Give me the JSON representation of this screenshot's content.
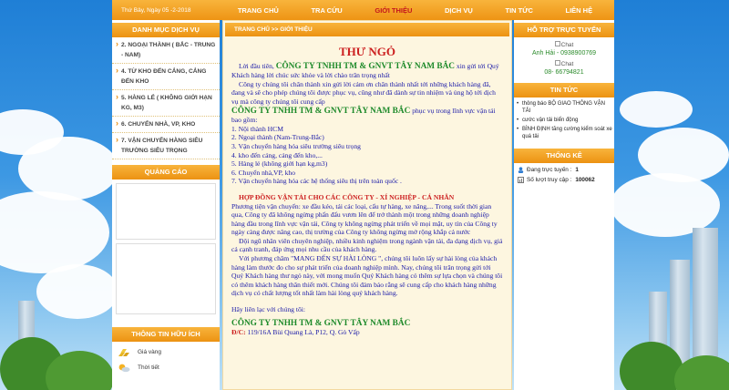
{
  "topbar": {
    "date": "Thứ Bảy, Ngày 05 -2-2018",
    "menu": [
      "TRANG CHỦ",
      "TRA CỨU",
      "GIỚI THIỆU",
      "DỊCH VỤ",
      "TIN TỨC",
      "LIÊN HỆ"
    ],
    "active_index": 2
  },
  "left": {
    "services_title": "DANH MỤC DỊCH VỤ",
    "services": [
      "2. NGOẠI THÀNH ( BẮC - TRUNG - NAM)",
      "4. TỪ KHO ĐẾN CẢNG, CẢNG ĐẾN KHO",
      "5. HÀNG LẺ ( KHÔNG GIỚI HẠN KG, M3)",
      "6. CHUYỂN NHÀ, VP, KHO",
      "7. VẬN CHUYỂN HÀNG SIÊU TRƯỜNG SIÊU TRỌNG"
    ],
    "ads_title": "QUẢNG CÁO",
    "useful_title": "THÔNG TIN HỮU ÍCH",
    "useful": [
      "Giá vàng",
      "Thời tiết"
    ]
  },
  "center": {
    "breadcrumb": "TRANG CHỦ >> GIỚI THIỆU",
    "title": "THƯ NGỎ",
    "company": "CÔNG TY TNHH TM & GNVT TÂY NAM BẮC",
    "intro_pre": "Lời đầu tiên,",
    "intro_post": "xin gửi tới Quý Khách hàng lời chúc sức khỏe và lời chào trân trọng nhất",
    "para1": "Công ty chúng tôi chân thành xin gửi lời cảm ơn chân thành nhất tới những khách hàng đã, đang và sẽ cho phép chúng tôi được phục vụ, cũng như đã dành sự tin nhiệm và ủng hộ tới dịch vụ mà công ty chúng tôi cung cấp",
    "serve_post": "phục vụ trong lĩnh vực vận tải bao gồm:",
    "list": [
      "1. Nội thành HCM",
      "2. Ngoại thành (Nam-Trung-Bắc)",
      "3. Vận chuyển hàng hóa siêu trường siêu trọng",
      "4. kho đến cảng, cảng đến kho,...",
      "5. Hàng lẻ (không giới hạn kg,m3)",
      "6. Chuyển nhà,VP, kho",
      "7. Vận chuyển hàng hóa các hệ thống siêu thị trên toàn quốc ."
    ],
    "contract_title": "HỢP ĐỒNG VẬN TẢI CHO CÁC CÔNG TY - XÍ NGHIỆP - CÁ NHÂN",
    "para2": "Phương tiện vận chuyển: xe đầu kéo, tải các loại, cẩu tự hàng, xe nâng,... Trong suốt thời gian qua, Công ty đã không ngừng phấn đấu vươn lên để trở thành một trong những doanh nghiệp hàng đầu trong lĩnh vực vận tải, Công ty không ngừng phát triển về mọi mặt, uy tín của Công ty ngày càng được nâng cao, thị trường của Công ty không ngừng mở rộng khắp cả nước",
    "para3": "Đội ngũ nhân viên chuyên nghiệp, nhiều kinh nghiệm trong ngành vận tải, đa dạng dịch vụ, giá cả cạnh tranh, đáp ứng mọi nhu cầu của khách hàng.",
    "para4": "Với phương châm \"MANG ĐẾN SỰ HÀI LÒNG \", chúng tôi luôn lấy sự hài lòng của khách hàng làm thước đo cho sự phát triển của doanh nghiệp mình. Nay, chúng tôi trân trọng gửi tới Quý Khách hàng thư ngỏ này, với mong muốn Quý Khách hàng có thêm sự lựa chọn và chúng tôi có thêm khách hàng thân thiết mới. Chúng tôi đảm bảo rằng sẽ cung cấp cho khách hàng những dịch vụ có chất lượng tốt nhất làm hài lòng quý khách hàng.",
    "contact_line": "Hãy liên lạc với chúng tôi:",
    "contact_company": "CÔNG TY TNHH TM & GNVT TÂY NAM BẮC",
    "address_label": "Đ/C:",
    "address": "119/16A Bùi Quang Là, P12, Q. Gò Vấp"
  },
  "right": {
    "support_title": "HỖ TRỢ TRỰC TUYẾN",
    "chat_alt": "Chat",
    "contact1": "Anh Hải - 0938900769",
    "contact2": "08- 66794821",
    "news_title": "TIN TỨC",
    "news": [
      "thông báo BỘ GIAO THÔNG VẬN TẢI",
      "cước vận tải biển động",
      "BÌNH ĐỊNH tăng cường kiểm soát xe quá tải"
    ],
    "stats_title": "THỐNG KÊ",
    "online_label": "Đang trực tuyến :",
    "online_value": "1",
    "visits_label": "Số lượt truy cập :",
    "visits_value": "100062"
  },
  "colors": {
    "orange": "#f1a024",
    "red": "#cc1f1f",
    "green": "#1d8a2a",
    "blue": "#1a1aa8"
  }
}
